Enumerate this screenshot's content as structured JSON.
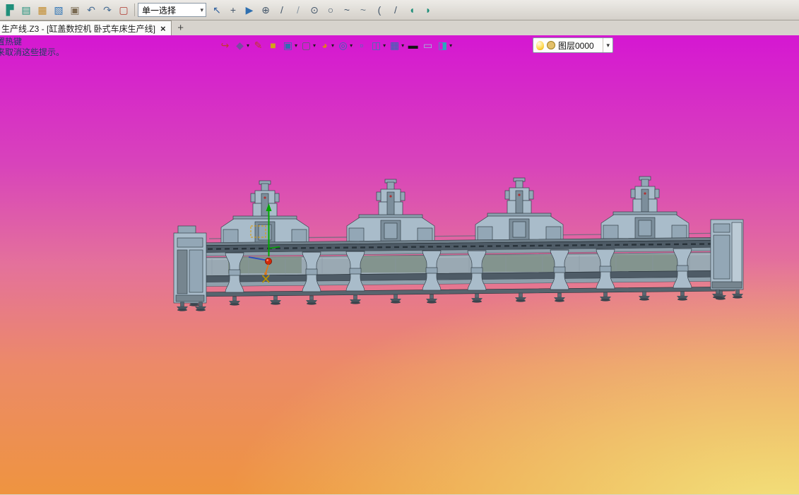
{
  "colors": {
    "g1": "#d517d2",
    "g2": "#d843bb",
    "g3": "#e4719b",
    "g4": "#ec8a68",
    "g5": "#ee9440",
    "g6": "#f2e27c",
    "hint_text": "#1c3e5e",
    "m_main": "#a9bcca",
    "m_mid": "#93a7b6",
    "m_dark": "#76858f",
    "m_cavity": "#7c8e9b",
    "m_deck": "#8ca0ae",
    "m_stroke": "#36424b",
    "rail_dark": "#4e5b66",
    "rail_light": "#8fa0ac",
    "bed_color": "#9aa9b3",
    "base_color": "#57646e",
    "bulb": "#ffd84d",
    "layer_swatch": "#e3c06a"
  },
  "toolbar": {
    "selection_mode": "单一选择",
    "caret_glyph": "▾",
    "left_icons": [
      {
        "name": "manager-tree-icon",
        "glyph": "▛",
        "color": "#1f8f7a"
      },
      {
        "name": "sheet-icon",
        "glyph": "▤",
        "color": "#1f8f7a"
      },
      {
        "name": "table-icon",
        "glyph": "▦",
        "color": "#c28a2a"
      },
      {
        "name": "image-icon",
        "glyph": "▧",
        "color": "#2f74b5"
      },
      {
        "name": "print-icon",
        "glyph": "▣",
        "color": "#7a6a52"
      },
      {
        "name": "undo-icon",
        "glyph": "↶",
        "color": "#4a6f96"
      },
      {
        "name": "redo-icon",
        "glyph": "↷",
        "color": "#4a6f96"
      },
      {
        "name": "record-stop-icon",
        "glyph": "▢",
        "color": "#b03a30"
      }
    ],
    "right_icons": [
      {
        "name": "pick-arrow-icon",
        "glyph": "↖",
        "color": "#2e5f9e"
      },
      {
        "name": "snap-point-icon",
        "glyph": "+",
        "color": "#44566a"
      },
      {
        "name": "play-circle-icon",
        "glyph": "▶",
        "color": "#2e6fb0"
      },
      {
        "name": "target-icon",
        "glyph": "⊕",
        "color": "#44566a"
      },
      {
        "name": "line-icon",
        "glyph": "/",
        "color": "#44566a"
      },
      {
        "name": "line-alt-icon",
        "glyph": "/",
        "color": "#8a98a4"
      },
      {
        "name": "circle-point-icon",
        "glyph": "⊙",
        "color": "#44566a"
      },
      {
        "name": "circle-icon",
        "glyph": "○",
        "color": "#44566a"
      },
      {
        "name": "spline-icon",
        "glyph": "~",
        "color": "#44566a"
      },
      {
        "name": "wave-icon",
        "glyph": "~",
        "color": "#6a7a86"
      },
      {
        "name": "arc-icon",
        "glyph": "(",
        "color": "#44566a"
      },
      {
        "name": "diagonal-icon",
        "glyph": "/",
        "color": "#44566a"
      },
      {
        "name": "fillet-icon",
        "glyph": "◖",
        "color": "#1f8f7a"
      },
      {
        "name": "chamfer-icon",
        "glyph": "◗",
        "color": "#1f8f7a"
      }
    ]
  },
  "tabbar": {
    "active_tab_label": "生产线.Z3 - [缸盖数控机 卧式车床生产线]",
    "close_glyph": "×",
    "new_tab_glyph": "+"
  },
  "view_toolbar": {
    "caret_glyph": "▾",
    "icons": [
      {
        "name": "exit-arrow-icon",
        "glyph": "↪",
        "color": "#c03a2e",
        "caret": false
      },
      {
        "name": "render-mode-icon",
        "glyph": "◆",
        "color": "#7a4aa0",
        "caret": true
      },
      {
        "name": "sketch-pencil-icon",
        "glyph": "✎",
        "color": "#c03a2e",
        "caret": false
      },
      {
        "name": "surface-box-icon",
        "glyph": "■",
        "color": "#d4a21a",
        "caret": false
      },
      {
        "name": "solid-cube-icon",
        "glyph": "▣",
        "color": "#2e6fb0",
        "caret": true
      },
      {
        "name": "wire-cube-icon",
        "glyph": "▢",
        "color": "#55636e",
        "caret": true
      },
      {
        "name": "color-sphere-icon",
        "glyph": "◕",
        "color": "#e07c22",
        "caret": true
      },
      {
        "name": "zoom-view-icon",
        "glyph": "◎",
        "color": "#2e6fb0",
        "caret": true
      },
      {
        "name": "window-select-icon",
        "glyph": "▫",
        "color": "#3a7ab0",
        "caret": false
      },
      {
        "name": "section-view-icon",
        "glyph": "◫",
        "color": "#3a7ab0",
        "caret": true
      },
      {
        "name": "monitor-icon",
        "glyph": "▦",
        "color": "#2e6fb0",
        "caret": true
      },
      {
        "name": "black-swatch-icon",
        "glyph": "▬",
        "color": "#141414",
        "caret": false
      },
      {
        "name": "panel-swatch-icon",
        "glyph": "▭",
        "color": "#9cc4d8",
        "caret": false
      },
      {
        "name": "shade-swatch-icon",
        "glyph": "◨",
        "color": "#2aa8bc",
        "caret": true
      }
    ],
    "layer": {
      "name": "图层0000",
      "caret": "▾"
    }
  },
  "viewport": {
    "hint_line1": "置热键",
    "hint_line2": "来取消这些提示。"
  }
}
